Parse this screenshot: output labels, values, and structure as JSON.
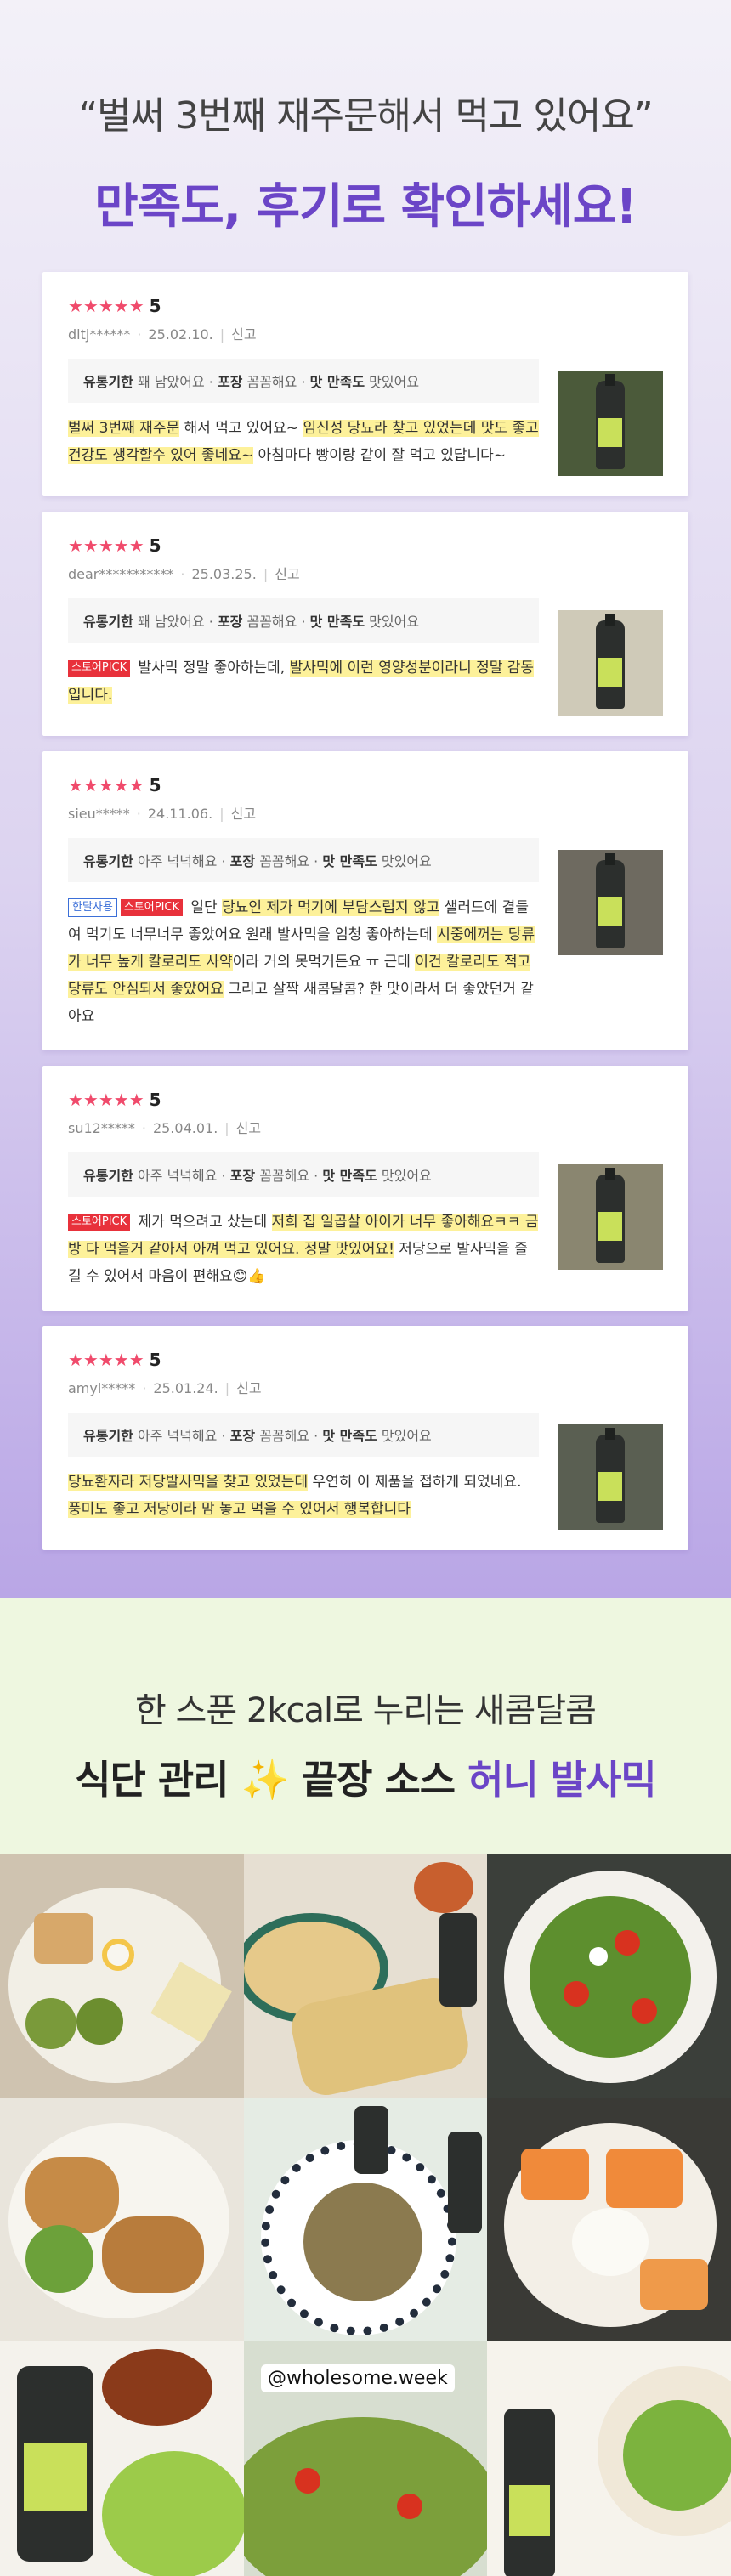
{
  "review_section": {
    "headline": "“벌써 3번째 재주문해서 먹고 있어요”",
    "subheadline": "만족도, 후기로 확인하세요!"
  },
  "reviews": [
    {
      "stars": "★★★★★",
      "score": "5",
      "user": "dltj******",
      "date": "25.02.10.",
      "report": "신고",
      "tags": [
        "유통기한",
        "꽤 남았어요",
        "포장",
        "꼼꼼해요",
        "맛 만족도",
        "맛있어요"
      ],
      "text": [
        {
          "t": "벌써 3번째 재주문",
          "hl": true
        },
        {
          "t": " 해서 먹고 있어요~ ",
          "hl": false
        },
        {
          "t": "임신성 당뇨라 찾고 있었는데 맛도 좋고 건강도 생각할수 있어 좋네요~",
          "hl": true
        },
        {
          "t": " 아침마다 빵이랑 같이 잘 먹고 있답니다~",
          "hl": false
        }
      ]
    },
    {
      "stars": "★★★★★",
      "score": "5",
      "user": "dear***********",
      "date": "25.03.25.",
      "report": "신고",
      "tags": [
        "유통기한",
        "꽤 남았어요",
        "포장",
        "꼼꼼해요",
        "맛 만족도",
        "맛있어요"
      ],
      "badges": [
        "스토어PICK"
      ],
      "text": [
        {
          "t": " 발사믹 정말 좋아하는데, ",
          "hl": false
        },
        {
          "t": "발사믹에 이런 영양성분이라니 정말 감동입니다.",
          "hl": true
        }
      ]
    },
    {
      "stars": "★★★★★",
      "score": "5",
      "user": "sieu*****",
      "date": "24.11.06.",
      "report": "신고",
      "tags": [
        "유통기한",
        "아주 넉넉해요",
        "포장",
        "꼼꼼해요",
        "맛 만족도",
        "맛있어요"
      ],
      "badges": [
        "한달사용",
        "스토어PICK"
      ],
      "text": [
        {
          "t": " 일단 ",
          "hl": false
        },
        {
          "t": "당뇨인 제가 먹기에 부담스럽지 않고",
          "hl": true
        },
        {
          "t": " 샐러드에 곁들여 먹기도 너무너무 좋았어요 원래 발사믹을 엄청 좋아하는데 ",
          "hl": false
        },
        {
          "t": "시중에꺼는 당류가 너무 높게 칼로리도 사약",
          "hl": true
        },
        {
          "t": "이라 거의 못먹거든요 ㅠ 근데 ",
          "hl": false
        },
        {
          "t": "이건 칼로리도 적고 당류도 안심되서 좋았어요",
          "hl": true
        },
        {
          "t": " 그리고 살짝 새콤달콤? 한 맛이라서 더 좋았던거 같아요",
          "hl": false
        }
      ]
    },
    {
      "stars": "★★★★★",
      "score": "5",
      "user": "su12*****",
      "date": "25.04.01.",
      "report": "신고",
      "tags": [
        "유통기한",
        "아주 넉넉해요",
        "포장",
        "꼼꼼해요",
        "맛 만족도",
        "맛있어요"
      ],
      "badges": [
        "스토어PICK"
      ],
      "text": [
        {
          "t": " 제가 먹으려고 샀는데 ",
          "hl": false
        },
        {
          "t": "저희 집 일곱살 아이가 너무 좋아해요ㅋㅋ 금방 다 먹을거 같아서 아껴 먹고 있어요. 정말 맛있어요!",
          "hl": true
        },
        {
          "t": " 저당으로 발사믹을 즐길 수 있어서 마음이 편해요😊👍",
          "hl": false
        }
      ]
    },
    {
      "stars": "★★★★★",
      "score": "5",
      "user": "amyl*****",
      "date": "25.01.24.",
      "report": "신고",
      "tags": [
        "유통기한",
        "아주 넉넉해요",
        "포장",
        "꼼꼼해요",
        "맛 만족도",
        "맛있어요"
      ],
      "text": [
        {
          "t": "당뇨환자라 저당발사믹을 찾고 있었는데",
          "hl": true
        },
        {
          "t": " 우연히 이 제품을 접하게 되었네요. ",
          "hl": false
        },
        {
          "t": "풍미도 좋고 저당이라 맘 놓고 먹을 수 있어서 행복합니다",
          "hl": true
        }
      ]
    }
  ],
  "recipe_section": {
    "line1": "한 스푼 2kcal로 누리는 새콤달콤",
    "line2_a": "식단 관리 ✨ 끝장 소스 ",
    "line2_b": "허니 발사믹",
    "instagram_handle": "@wholesome.week"
  },
  "colors": {
    "accent_purple": "#6b45c7",
    "star_pink": "#f04a6b",
    "highlight_yellow": "#fdf19a",
    "badge_red": "#e8313b"
  }
}
